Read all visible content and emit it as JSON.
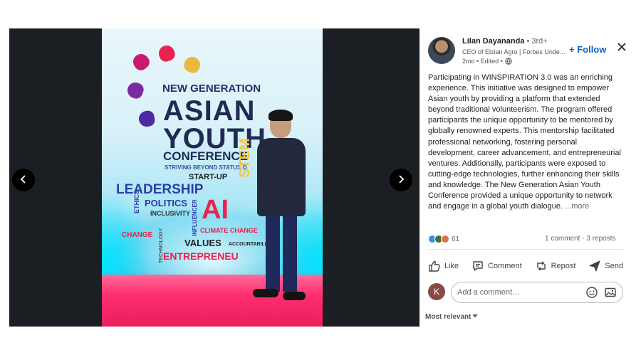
{
  "poster": {
    "new_generation": "NEW GENERATION",
    "asian": "ASIAN",
    "youth": "YOUTH",
    "conference": "CONFERENCE",
    "striving": "STRIVING BEYOND STATUS Q",
    "startup": "START-UP",
    "leadership": "LEADERSHIP",
    "politics": "POLITICS",
    "inclusivity": "INCLUSIVITY",
    "ai": "AI",
    "stem": "STEM",
    "change": "CHANGE",
    "climate_change": "CLIMATE CHANGE",
    "values": "VALUES",
    "accountability": "ACCOUNTABILI",
    "entrepreneurship": "ENTREPRENEU",
    "ethics": "ETHICS",
    "technology": "TECHNOLOGY",
    "influencer": "INFLUENCER"
  },
  "viewer": {
    "prev_icon": "chevron-left-icon",
    "next_icon": "chevron-right-icon"
  },
  "post": {
    "author_name": "Lilan Dayananda",
    "separator": "•",
    "connection_degree": "3rd+",
    "headline": "CEO of Elzian Agro | Forbes Unde...",
    "meta_time": "2mo • Edited •",
    "follow_label": "+ Follow",
    "text": "Participating in WINSPIRATION 3.0 was an enriching experience. This initiative was designed to empower Asian youth by providing a platform that extended beyond traditional volunteerism. The program offered participants the unique opportunity to be mentored by globally renowned experts. This mentorship facilitated professional networking, fostering personal development, career advancement, and entrepreneurial ventures. Additionally, participants were exposed to cutting-edge technologies, further enhancing their skills and knowledge. The New Generation Asian Youth Conference provided a unique opportunity to network and engage in a global youth dialogue.",
    "more_label": "...more",
    "reaction_count": "61",
    "stats": "1 comment · 3 reposts"
  },
  "actions": {
    "like": "Like",
    "comment": "Comment",
    "repost": "Repost",
    "send": "Send"
  },
  "comment": {
    "avatar_initial": "K",
    "placeholder": "Add a comment…"
  },
  "sort_label": "Most relevant",
  "colors": {
    "brand_blue": "#0a66c2",
    "viewer_bg": "#1b1f23",
    "avatar_k": "#8a4a44"
  }
}
